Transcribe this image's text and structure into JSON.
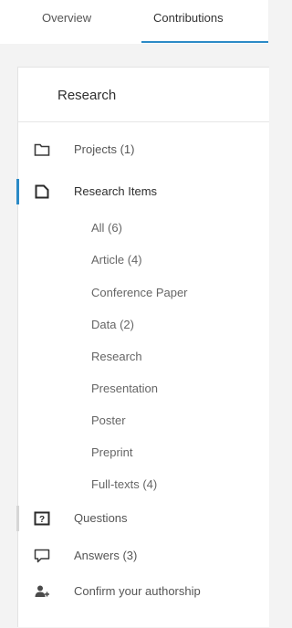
{
  "tabs": {
    "overview": "Overview",
    "contributions": "Contributions"
  },
  "panel": {
    "title": "Research",
    "nav": {
      "projects": "Projects (1)",
      "research_items": "Research Items",
      "questions": "Questions",
      "answers": "Answers (3)",
      "confirm_authorship": "Confirm your authorship"
    },
    "sub_items": [
      "All (6)",
      "Article (4)",
      "Conference Paper",
      "Data (2)",
      "Research",
      "Presentation",
      "Poster",
      "Preprint",
      "Full-texts (4)"
    ]
  },
  "colors": {
    "accent": "#2b8ac6",
    "background": "#f3f3f3",
    "panel": "#ffffff"
  },
  "icons": {
    "projects": "folder-icon",
    "research_items": "document-icon",
    "questions": "question-box-icon",
    "answers": "speech-bubble-icon",
    "confirm_authorship": "add-person-icon"
  }
}
